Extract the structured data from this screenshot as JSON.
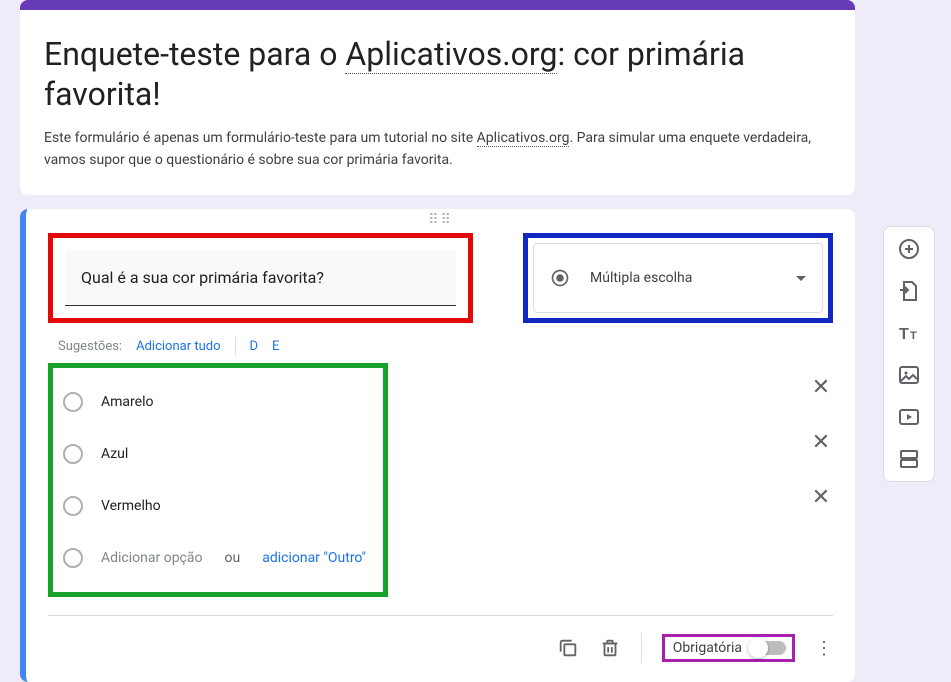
{
  "header": {
    "title_before": "Enquete-teste para o ",
    "title_link": "Aplicativos.org",
    "title_after": ": cor primária favorita!",
    "desc_before": "Este formulário é apenas um formulário-teste para um tutorial no site ",
    "desc_link": "Aplicativos.org",
    "desc_after": ". Para simular uma enquete verdadeira, vamos supor que o questionário é sobre sua cor primária favorita."
  },
  "question": {
    "text": "Qual é a sua cor primária favorita?",
    "type_label": "Múltipla escolha"
  },
  "suggestions": {
    "label": "Sugestões:",
    "add_all": "Adicionar tudo",
    "s1": "D",
    "s2": "E"
  },
  "options": {
    "o1": "Amarelo",
    "o2": "Azul",
    "o3": "Vermelho",
    "add_option": "Adicionar opção",
    "or": "ou",
    "add_other": "adicionar \"Outro\""
  },
  "footer": {
    "required_label": "Obrigatória"
  }
}
